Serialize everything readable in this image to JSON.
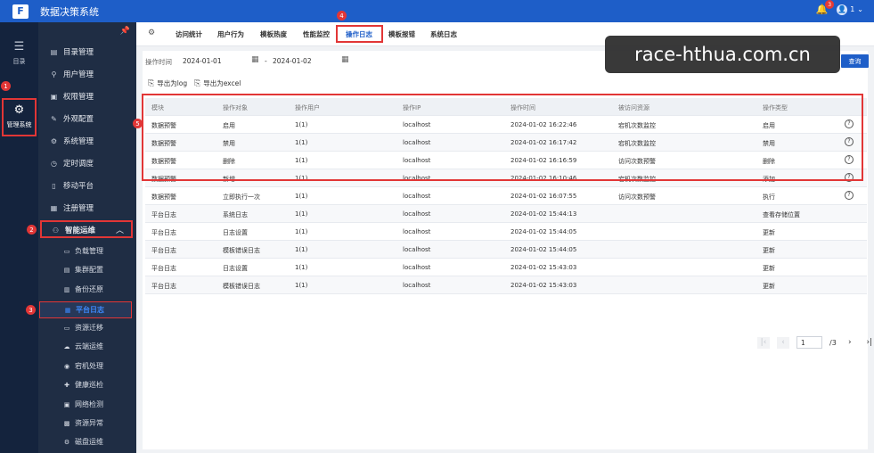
{
  "app": {
    "title": "数据决策系统",
    "logo_letter": "F"
  },
  "header": {
    "notification_count": "3",
    "user_label": "1"
  },
  "rail": {
    "items": [
      {
        "label": "目录",
        "icon": "list-icon"
      },
      {
        "label": "管理系统",
        "icon": "gear-icon"
      }
    ]
  },
  "sidebar": {
    "items": [
      {
        "label": "目录管理",
        "icon": "catalog-icon"
      },
      {
        "label": "用户管理",
        "icon": "user-icon"
      },
      {
        "label": "权限管理",
        "icon": "permission-icon"
      },
      {
        "label": "外观配置",
        "icon": "appearance-icon"
      },
      {
        "label": "系统管理",
        "icon": "system-icon"
      },
      {
        "label": "定时调度",
        "icon": "clock-icon"
      },
      {
        "label": "移动平台",
        "icon": "mobile-icon"
      },
      {
        "label": "注册管理",
        "icon": "register-icon"
      }
    ],
    "ops_label": "智能运维",
    "sub_items": [
      "负载管理",
      "集群配置",
      "备份还原",
      "平台日志",
      "资源迁移",
      "云端运维",
      "宕机处理",
      "健康巡检",
      "网络检测",
      "资源异常",
      "磁盘运维"
    ]
  },
  "tabs": [
    "访问统计",
    "用户行为",
    "模板热度",
    "性能监控",
    "操作日志",
    "模板报错",
    "系统日志"
  ],
  "filters": {
    "label": "操作时间",
    "start_date": "2024-01-01",
    "separator": "-",
    "end_date": "2024-01-02",
    "query_label": "查询"
  },
  "exports": {
    "log": "导出为log",
    "excel": "导出为excel"
  },
  "table": {
    "columns": [
      "模块",
      "操作对象",
      "操作用户",
      "操作IP",
      "操作时间",
      "被访问资源",
      "操作类型"
    ],
    "rows": [
      [
        "数据预警",
        "启用",
        "1(1)",
        "localhost",
        "2024-01-02 16:22:46",
        "宕机次数监控",
        "启用"
      ],
      [
        "数据预警",
        "禁用",
        "1(1)",
        "localhost",
        "2024-01-02 16:17:42",
        "宕机次数监控",
        "禁用"
      ],
      [
        "数据预警",
        "删除",
        "1(1)",
        "localhost",
        "2024-01-02 16:16:59",
        "访问次数预警",
        "删除"
      ],
      [
        "数据预警",
        "新增",
        "1(1)",
        "localhost",
        "2024-01-02 16:10:46",
        "宕机次数监控",
        "添加"
      ],
      [
        "数据预警",
        "立即执行一次",
        "1(1)",
        "localhost",
        "2024-01-02 16:07:55",
        "访问次数预警",
        "执行"
      ],
      [
        "平台日志",
        "系统日志",
        "1(1)",
        "localhost",
        "2024-01-02 15:44:13",
        "",
        "查看存储位置"
      ],
      [
        "平台日志",
        "日志设置",
        "1(1)",
        "localhost",
        "2024-01-02 15:44:05",
        "",
        "更新"
      ],
      [
        "平台日志",
        "模板错误日志",
        "1(1)",
        "localhost",
        "2024-01-02 15:44:05",
        "",
        "更新"
      ],
      [
        "平台日志",
        "日志设置",
        "1(1)",
        "localhost",
        "2024-01-02 15:43:03",
        "",
        "更新"
      ],
      [
        "平台日志",
        "模板错误日志",
        "1(1)",
        "localhost",
        "2024-01-02 15:43:03",
        "",
        "更新"
      ]
    ]
  },
  "pager": {
    "current": "1",
    "total": "/3"
  },
  "markers": [
    "1",
    "2",
    "3",
    "4",
    "5"
  ],
  "watermark": "race-hthua.com.cn",
  "colors": {
    "brand": "#1e5ec8",
    "annotation": "#e23636",
    "sidebar": "#1f2d44"
  }
}
